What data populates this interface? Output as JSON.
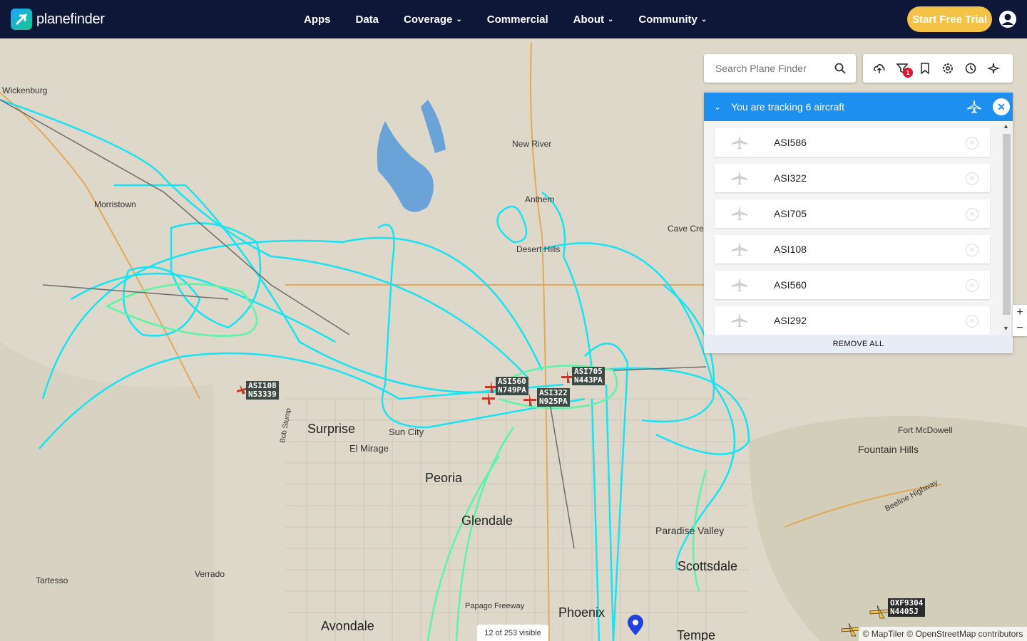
{
  "brand": {
    "name": "planefinder"
  },
  "nav": {
    "items": [
      {
        "label": "Apps"
      },
      {
        "label": "Data"
      },
      {
        "label": "Coverage"
      },
      {
        "label": "Commercial"
      },
      {
        "label": "About"
      },
      {
        "label": "Community"
      }
    ],
    "trial_label": "Start Free Trial"
  },
  "search": {
    "placeholder": "Search Plane Finder"
  },
  "toolbar": {
    "filter_badge": "1"
  },
  "tracking": {
    "title": "You are tracking 6 aircraft",
    "aircraft": [
      "ASI586",
      "ASI322",
      "ASI705",
      "ASI108",
      "ASI560",
      "ASI292"
    ],
    "remove_all": "REMOVE ALL"
  },
  "map": {
    "places": [
      {
        "name": "Wickenburg"
      },
      {
        "name": "Morristown"
      },
      {
        "name": "New River"
      },
      {
        "name": "Anthem"
      },
      {
        "name": "Cave Cree"
      },
      {
        "name": "Desert Hills"
      },
      {
        "name": "Surprise"
      },
      {
        "name": "Sun City"
      },
      {
        "name": "El Mirage"
      },
      {
        "name": "Peoria"
      },
      {
        "name": "Glendale"
      },
      {
        "name": "Paradise Valley"
      },
      {
        "name": "Scottsdale"
      },
      {
        "name": "Phoenix"
      },
      {
        "name": "Avondale"
      },
      {
        "name": "Tartesso"
      },
      {
        "name": "Verrado"
      },
      {
        "name": "Fort McDowell"
      },
      {
        "name": "Fountain Hills"
      },
      {
        "name": "Tempe"
      },
      {
        "name": "Papago Freeway"
      },
      {
        "name": "Beeline Highway"
      },
      {
        "name": "Bob Stump"
      }
    ],
    "aircraft_tags": [
      {
        "callsign": "ASI108",
        "reg": "N53339"
      },
      {
        "callsign": "ASI560",
        "reg": "N749PA"
      },
      {
        "callsign": "ASI322",
        "reg": "N925PA"
      },
      {
        "callsign": "ASI705",
        "reg": "N443PA"
      },
      {
        "callsign": "OXF9304",
        "reg": "N4405J"
      }
    ],
    "visible_count": "12 of 253 visible",
    "attribution": "© MapTiler © OpenStreetMap contributors",
    "track_colors": {
      "primary": "#16e4f5",
      "secondary": "#5cf5a8"
    }
  },
  "zoom": {
    "in": "+",
    "out": "−"
  }
}
